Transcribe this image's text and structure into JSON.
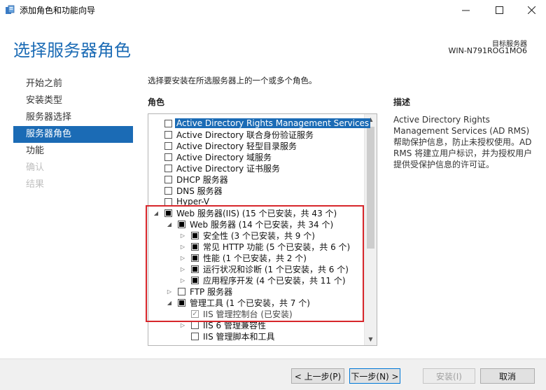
{
  "window": {
    "title": "添加角色和功能向导",
    "icons": {
      "app": "server-manager-icon",
      "min": "minimize-icon",
      "max": "maximize-icon",
      "close": "close-icon"
    }
  },
  "header": {
    "page_title": "选择服务器角色",
    "target_label": "目标服务器",
    "target_name": "WIN-N791ROG1MO6"
  },
  "nav": {
    "items": [
      {
        "label": "开始之前",
        "state": "normal"
      },
      {
        "label": "安装类型",
        "state": "normal"
      },
      {
        "label": "服务器选择",
        "state": "normal"
      },
      {
        "label": "服务器角色",
        "state": "active"
      },
      {
        "label": "功能",
        "state": "normal"
      },
      {
        "label": "确认",
        "state": "disabled"
      },
      {
        "label": "结果",
        "state": "disabled"
      }
    ]
  },
  "main": {
    "intro": "选择要安装在所选服务器上的一个或多个角色。",
    "roles_label": "角色",
    "description_label": "描述",
    "description_text": "Active Directory Rights Management Services (AD RMS) 帮助保护信息，防止未授权使用。AD RMS 将建立用户标识，并为授权用户提供受保护信息的许可证。",
    "roles": [
      {
        "label": "Active Directory Rights Management Services",
        "level": 0,
        "expander": "",
        "check": "none",
        "selected": true
      },
      {
        "label": "Active Directory 联合身份验证服务",
        "level": 0,
        "expander": "",
        "check": "none"
      },
      {
        "label": "Active Directory 轻型目录服务",
        "level": 0,
        "expander": "",
        "check": "none"
      },
      {
        "label": "Active Directory 域服务",
        "level": 0,
        "expander": "",
        "check": "none"
      },
      {
        "label": "Active Directory 证书服务",
        "level": 0,
        "expander": "",
        "check": "none"
      },
      {
        "label": "DHCP 服务器",
        "level": 0,
        "expander": "",
        "check": "none"
      },
      {
        "label": "DNS 服务器",
        "level": 0,
        "expander": "",
        "check": "none"
      },
      {
        "label": "Hyper-V",
        "level": 0,
        "expander": "",
        "check": "none"
      },
      {
        "label": "Web 服务器(IIS) (15 个已安装，共 43 个)",
        "level": 0,
        "expander": "◢",
        "check": "partial"
      },
      {
        "label": "Web 服务器 (14 个已安装，共 34 个)",
        "level": 1,
        "expander": "◢",
        "check": "partial"
      },
      {
        "label": "安全性 (3 个已安装，共 9 个)",
        "level": 2,
        "expander": "▷",
        "check": "partial"
      },
      {
        "label": "常见 HTTP 功能 (5 个已安装，共 6 个)",
        "level": 2,
        "expander": "▷",
        "check": "partial"
      },
      {
        "label": "性能 (1 个已安装，共 2 个)",
        "level": 2,
        "expander": "▷",
        "check": "partial"
      },
      {
        "label": "运行状况和诊断 (1 个已安装，共 6 个)",
        "level": 2,
        "expander": "▷",
        "check": "partial"
      },
      {
        "label": "应用程序开发 (4 个已安装，共 11 个)",
        "level": 2,
        "expander": "▷",
        "check": "partial"
      },
      {
        "label": "FTP 服务器",
        "level": 1,
        "expander": "▷",
        "check": "none"
      },
      {
        "label": "管理工具 (1 个已安装，共 7 个)",
        "level": 1,
        "expander": "◢",
        "check": "partial"
      },
      {
        "label": "IIS 管理控制台 (已安装)",
        "level": 2,
        "expander": "",
        "check": "checked",
        "grey": true
      },
      {
        "label": "IIS 6 管理兼容性",
        "level": 2,
        "expander": "▷",
        "check": "none"
      },
      {
        "label": "IIS 管理脚本和工具",
        "level": 2,
        "expander": "",
        "check": "none"
      }
    ]
  },
  "footer": {
    "prev": "< 上一步(P)",
    "next": "下一步(N) >",
    "install": "安装(I)",
    "cancel": "取消"
  },
  "colors": {
    "accent": "#1b6bb5",
    "highlight_box": "#d7262b"
  }
}
